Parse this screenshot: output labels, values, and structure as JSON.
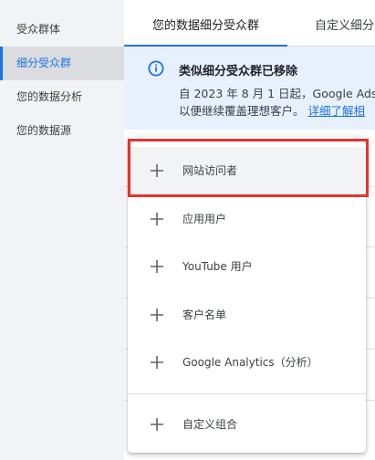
{
  "sidebar": {
    "items": [
      {
        "label": "受众群体"
      },
      {
        "label": "细分受众群",
        "active": true
      },
      {
        "label": "您的数据分析"
      },
      {
        "label": "您的数据源"
      }
    ]
  },
  "tabs": [
    {
      "label": "您的数据细分受众群"
    },
    {
      "label": "自定义细分"
    }
  ],
  "banner": {
    "icon": "info-icon",
    "title": "类似细分受众群已移除",
    "line1": "自 2023 年 8 月 1 日起，Google Ads",
    "line2": "以便继续覆盖理想客户。",
    "link": "详细了解相"
  },
  "menu": {
    "items": [
      {
        "label": "网站访问者",
        "icon": "plus-icon"
      },
      {
        "label": "应用用户",
        "icon": "plus-icon"
      },
      {
        "label": "YouTube 用户",
        "icon": "plus-icon"
      },
      {
        "label": "客户名单",
        "icon": "plus-icon"
      },
      {
        "label": "Google Analytics（分析）",
        "icon": "plus-icon"
      },
      {
        "label": "自定义组合",
        "icon": "plus-icon"
      }
    ]
  },
  "colors": {
    "accent": "#1a73e8",
    "banner_bg": "#e8f0fe",
    "highlight": "#e8312a",
    "sidebar_bg": "#f1f3f4"
  }
}
